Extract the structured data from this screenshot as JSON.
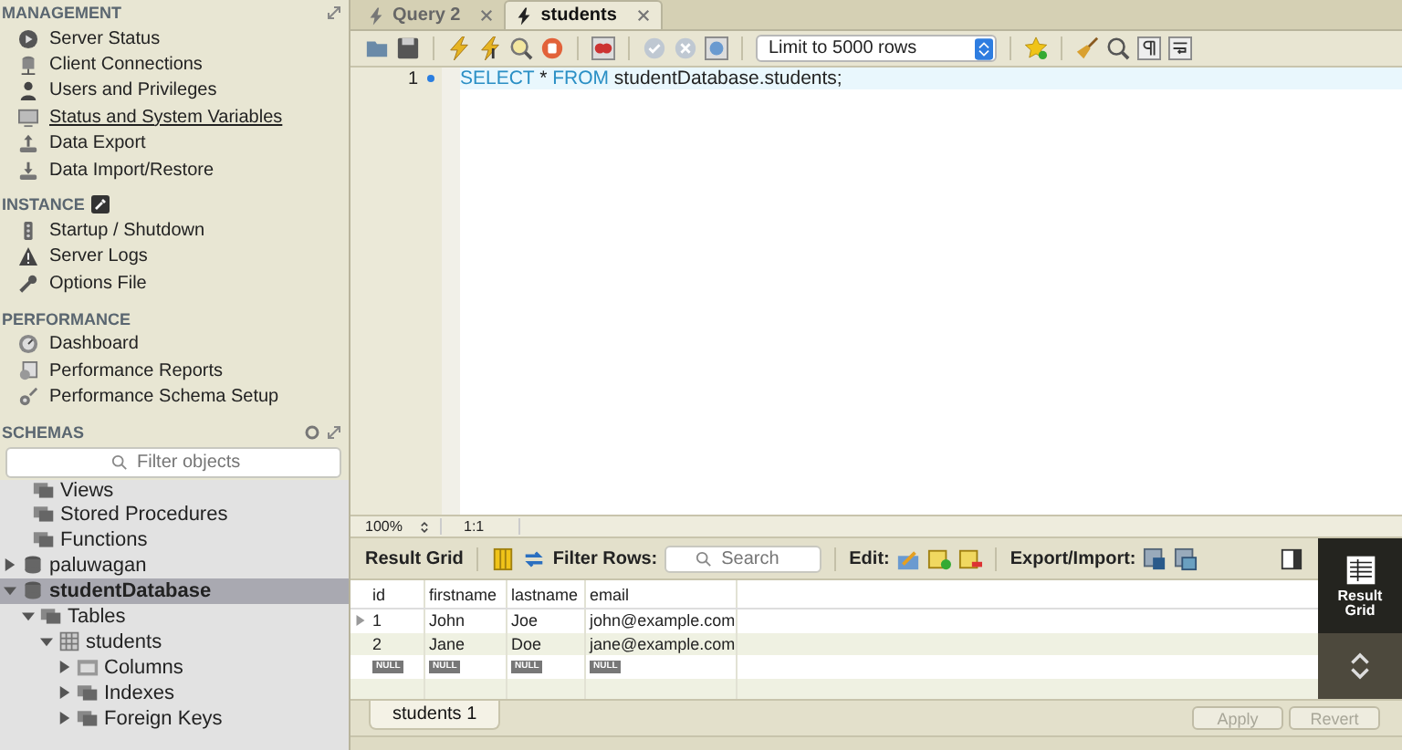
{
  "sidebar": {
    "sections": [
      {
        "title": "MANAGEMENT",
        "items": [
          {
            "label": "Server Status",
            "selected": false
          },
          {
            "label": "Client Connections",
            "selected": false
          },
          {
            "label": "Users and Privileges",
            "selected": false
          },
          {
            "label": "Status and System Variables",
            "selected": true
          },
          {
            "label": "Data Export",
            "selected": false
          },
          {
            "label": "Data Import/Restore",
            "selected": false
          }
        ]
      },
      {
        "title": "INSTANCE",
        "items": [
          {
            "label": "Startup / Shutdown",
            "selected": false
          },
          {
            "label": "Server Logs",
            "selected": false
          },
          {
            "label": "Options File",
            "selected": false
          }
        ]
      },
      {
        "title": "PERFORMANCE",
        "items": [
          {
            "label": "Dashboard",
            "selected": false
          },
          {
            "label": "Performance Reports",
            "selected": false
          },
          {
            "label": "Performance Schema Setup",
            "selected": false
          }
        ]
      }
    ],
    "schemas": {
      "title": "SCHEMAS",
      "filter": {
        "placeholder": "Filter objects"
      },
      "previous_items": [
        {
          "label": "Views",
          "kind": "folder"
        },
        {
          "label": "Stored Procedures",
          "kind": "folder"
        },
        {
          "label": "Functions",
          "kind": "folder"
        }
      ],
      "tree": [
        {
          "label": "paluwagan",
          "kind": "schema",
          "expanded": false,
          "selected": false
        },
        {
          "label": "studentDatabase",
          "kind": "schema",
          "expanded": true,
          "selected": true,
          "children": [
            {
              "label": "Tables",
              "kind": "folder",
              "expanded": true,
              "selected": false,
              "children": [
                {
                  "label": "students",
                  "kind": "table",
                  "expanded": true,
                  "selected": false,
                  "children": [
                    {
                      "label": "Columns",
                      "kind": "columns",
                      "expanded": false,
                      "selected": false
                    },
                    {
                      "label": "Indexes",
                      "kind": "folder",
                      "expanded": false,
                      "selected": false
                    },
                    {
                      "label": "Foreign Keys",
                      "kind": "folder",
                      "expanded": false,
                      "selected": false
                    }
                  ]
                }
              ]
            }
          ]
        }
      ]
    }
  },
  "tabs": [
    {
      "label": "Query 2",
      "selected": false
    },
    {
      "label": "students",
      "selected": true
    }
  ],
  "toolbar": {
    "limit": "Limit to 5000 rows"
  },
  "editor": {
    "lines": [
      {
        "number": "1",
        "tokens": [
          {
            "text": "SELECT",
            "kind": "keyword"
          },
          {
            "text": " * ",
            "kind": "plain"
          },
          {
            "text": "FROM",
            "kind": "keyword"
          },
          {
            "text": " studentDatabase.students;",
            "kind": "plain"
          }
        ]
      }
    ]
  },
  "status": {
    "zoom": "100%",
    "position": "1:1"
  },
  "results": {
    "title": "Result Grid",
    "filter_label": "Filter Rows:",
    "search": {
      "placeholder": "Search"
    },
    "edit_label": "Edit:",
    "export_label": "Export/Import:",
    "columns": [
      "id",
      "firstname",
      "lastname",
      "email"
    ],
    "rows": [
      {
        "current": true,
        "kind": "value",
        "cells": [
          "1",
          "John",
          "Joe",
          "john@example.com"
        ]
      },
      {
        "current": false,
        "kind": "value",
        "cells": [
          "2",
          "Jane",
          "Doe",
          "jane@example.com"
        ]
      },
      {
        "current": false,
        "kind": "null",
        "cells": [
          "NULL",
          "NULL",
          "NULL",
          "NULL"
        ]
      }
    ],
    "side_button": "Result Grid"
  },
  "result_tabs": [
    {
      "label": "students 1",
      "selected": true
    }
  ],
  "buttons": [
    {
      "label": "Apply",
      "disabled": true
    },
    {
      "label": "Revert",
      "disabled": true
    }
  ]
}
